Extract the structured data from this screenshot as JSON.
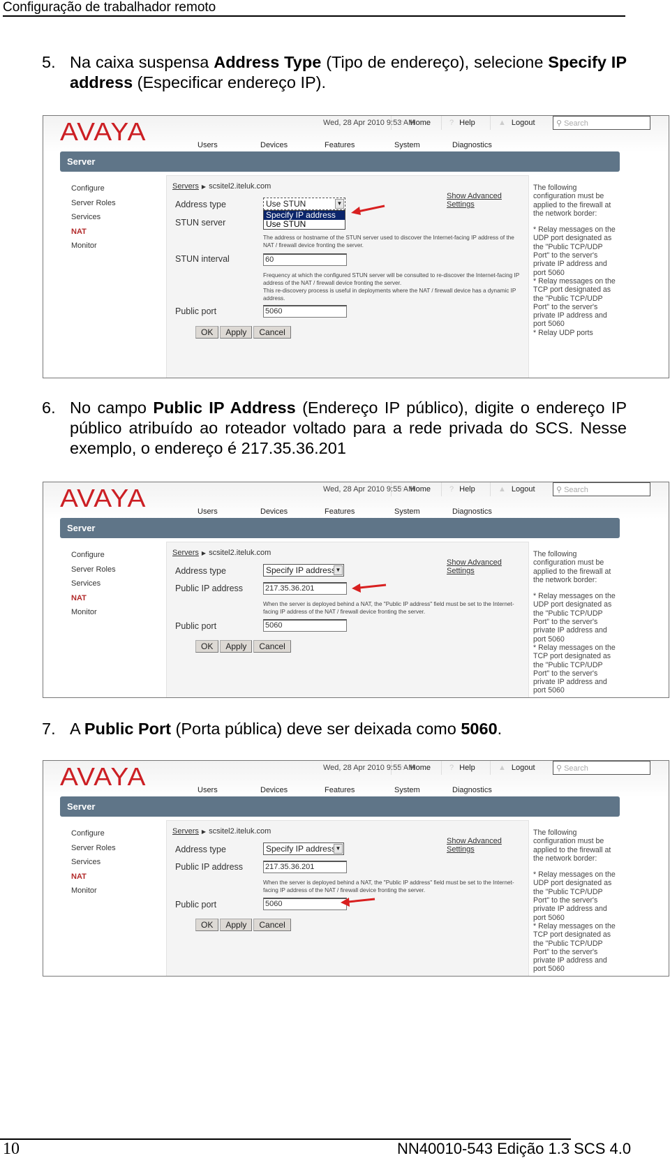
{
  "document": {
    "header_title": "Configuração de trabalhador remoto",
    "page_number": "10",
    "doc_id": "NN40010-543 Edição 1.3 SCS 4.0"
  },
  "steps": [
    {
      "number": "5.",
      "parts": [
        {
          "text": "Na caixa suspensa ",
          "bold": false
        },
        {
          "text": "Address Type",
          "bold": true
        },
        {
          "text": " (Tipo de endereço), selecione ",
          "bold": false
        },
        {
          "text": "Specify IP address",
          "bold": true
        },
        {
          "text": " (Especificar endereço IP).",
          "bold": false
        }
      ]
    },
    {
      "number": "6.",
      "parts": [
        {
          "text": "No campo ",
          "bold": false
        },
        {
          "text": "Public IP Address",
          "bold": true
        },
        {
          "text": " (Endereço IP público), digite o endereço IP público atribuído ao roteador voltado para a rede privada do SCS. Nesse exemplo, o endereço é 217.35.36.201",
          "bold": false
        }
      ]
    },
    {
      "number": "7.",
      "parts": [
        {
          "text": "A ",
          "bold": false
        },
        {
          "text": "Public Port",
          "bold": true
        },
        {
          "text": " (Porta pública) deve ser deixada como ",
          "bold": false
        },
        {
          "text": "5060",
          "bold": true
        },
        {
          "text": ".",
          "bold": false
        }
      ]
    }
  ],
  "app": {
    "logo": "AVAYA",
    "brand_color": "#cc1f24",
    "server_bar_color": "#5f7588",
    "top_links": {
      "home": "Home",
      "help": "Help",
      "logout": "Logout"
    },
    "top_icons": {
      "home": "home-icon",
      "help": "question-icon",
      "logout": "lock-icon",
      "search": "magnifier-icon"
    },
    "search_placeholder": "Search",
    "nav": [
      "Users",
      "Devices",
      "Features",
      "System",
      "Diagnostics"
    ],
    "section_title": "Server",
    "sidebar": [
      "Configure",
      "Server Roles",
      "Services",
      "NAT",
      "Monitor"
    ],
    "sidebar_active": "NAT",
    "breadcrumb_link": "Servers",
    "breadcrumb_current": "scsitel2.iteluk.com",
    "advanced_link": "Show Advanced Settings",
    "buttons": {
      "ok": "OK",
      "apply": "Apply",
      "cancel": "Cancel"
    },
    "sidenote": {
      "intro": "The following configuration must be applied to the firewall at the network border:",
      "bullet_udp": "* Relay messages on the UDP port designated as the \"Public TCP/UDP Port\" to the server's private IP address and port 5060",
      "bullet_tcp": "* Relay messages on the TCP port designated as the \"Public TCP/UDP Port\" to the server's private IP address and port 5060",
      "bullet_udp_ports": "* Relay UDP ports"
    }
  },
  "screenshots": [
    {
      "datetime": "Wed, 28 Apr 2010 9:53 AM",
      "address_type_label": "Address type",
      "address_type_value": "Use STUN",
      "dropdown_options": [
        "Specify IP address",
        "Use STUN"
      ],
      "dropdown_highlighted": "Specify IP address",
      "stun_server_label": "STUN server",
      "stun_server_help": "The address or hostname of the STUN server used to discover the Internet-facing IP address of the NAT / firewall device fronting the server.",
      "stun_interval_label": "STUN interval",
      "stun_interval_value": "60",
      "stun_interval_help": "Frequency at which the configured STUN server will be consulted to re-discover the Internet-facing IP address of the NAT / firewall device fronting the server.",
      "stun_interval_help2": "This re-discovery process is useful in deployments where the NAT / firewall device has a dynamic IP address.",
      "public_port_label": "Public port",
      "public_port_value": "5060"
    },
    {
      "datetime": "Wed, 28 Apr 2010 9:55 AM",
      "address_type_label": "Address type",
      "address_type_value": "Specify IP address",
      "public_ip_label": "Public IP address",
      "public_ip_value": "217.35.36.201",
      "public_ip_help": "When the server is deployed behind a NAT, the \"Public IP address\" field must be set to the Internet-facing IP address of the NAT / firewall device fronting the server.",
      "public_port_label": "Public port",
      "public_port_value": "5060"
    },
    {
      "datetime": "Wed, 28 Apr 2010 9:55 AM",
      "address_type_label": "Address type",
      "address_type_value": "Specify IP address",
      "public_ip_label": "Public IP address",
      "public_ip_value": "217.35.36.201",
      "public_ip_help": "When the server is deployed behind a NAT, the \"Public IP address\" field must be set to the Internet-facing IP address of the NAT / firewall device fronting the server.",
      "public_port_label": "Public port",
      "public_port_value": "5060"
    }
  ]
}
